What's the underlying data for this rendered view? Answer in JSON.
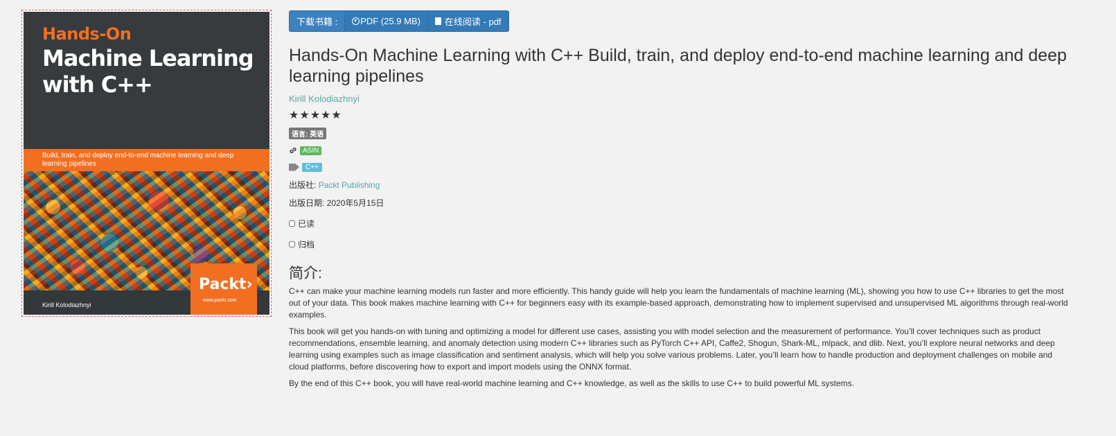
{
  "cover": {
    "kicker": "Hands-On",
    "title": "Machine Learning with C++",
    "subtitle": "Build, train, and deploy end-to-end machine learning and deep learning pipelines",
    "publisher_logo": "Packt›",
    "publisher_url": "www.packt.com",
    "author": "Kirill Kolodiazhnyi"
  },
  "download": {
    "label": "下载书籍 :",
    "pdf": "PDF (25.9 MB)",
    "read_online": "在线阅读 - pdf"
  },
  "book": {
    "title": "Hands-On Machine Learning with C++ Build, train, and deploy end-to-end machine learning and deep learning pipelines",
    "author": "Kirill Kolodiazhnyi",
    "stars": "★★★★★",
    "language": "语言: 英语",
    "asin": "ASIN",
    "tag": "C++",
    "publisher_label": "出版社:",
    "publisher": "Packt Publishing",
    "date_label": "出版日期:",
    "date": "2020年5月15日",
    "read_label": "已读",
    "archive_label": "归档"
  },
  "intro": {
    "heading": "简介:",
    "paragraphs": [
      "C++ can make your machine learning models run faster and more efficiently. This handy guide will help you learn the fundamentals of machine learning (ML), showing you how to use C++ libraries to get the most out of your data. This book makes machine learning with C++ for beginners easy with its example-based approach, demonstrating how to implement supervised and unsupervised ML algorithms through real-world examples.",
      "This book will get you hands-on with tuning and optimizing a model for different use cases, assisting you with model selection and the measurement of performance. You’ll cover techniques such as product recommendations, ensemble learning, and anomaly detection using modern C++ libraries such as PyTorch C++ API, Caffe2, Shogun, Shark-ML, mlpack, and dlib. Next, you’ll explore neural networks and deep learning using examples such as image classification and sentiment analysis, which will help you solve various problems. Later, you’ll learn how to handle production and deployment challenges on mobile and cloud platforms, before discovering how to export and import models using the ONNX format.",
      "By the end of this C++ book, you will have real-world machine learning and C++ knowledge, as well as the skills to use C++ to build powerful ML systems."
    ]
  },
  "colors": {
    "accent_orange": "#f26f21",
    "button_blue": "#337ab7",
    "link_teal": "#5aa8a1",
    "asin_green": "#5cb85c",
    "tag_blue": "#5bc0de"
  }
}
